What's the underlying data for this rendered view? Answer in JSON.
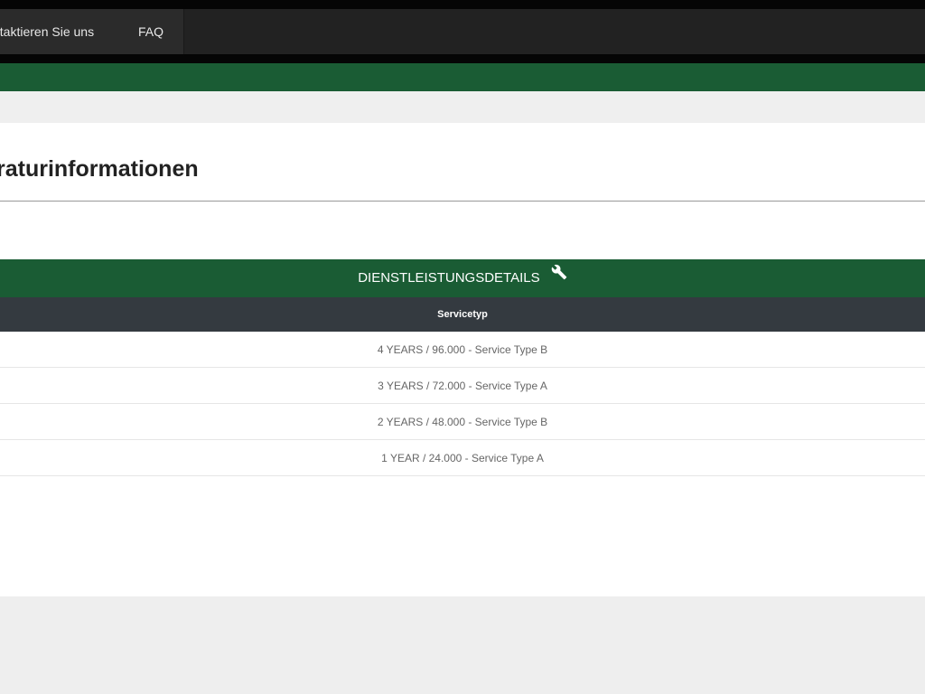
{
  "nav": {
    "contact_label": "ntaktieren Sie uns",
    "faq_label": "FAQ"
  },
  "page": {
    "title": "raturinformationen"
  },
  "service_table": {
    "header": "DIENSTLEISTUNGSDETAILS",
    "header_icon": "wrench-icon",
    "column_header": "Servicetyp",
    "rows": [
      "4 YEARS / 96.000 - Service Type B",
      "3 YEARS / 72.000 - Service Type A",
      "2 YEARS / 48.000 - Service Type B",
      "1 YEAR / 24.000 - Service Type A"
    ]
  },
  "colors": {
    "brand_green": "#1a5c34",
    "navbar": "#222222",
    "column_header": "#343a40"
  }
}
